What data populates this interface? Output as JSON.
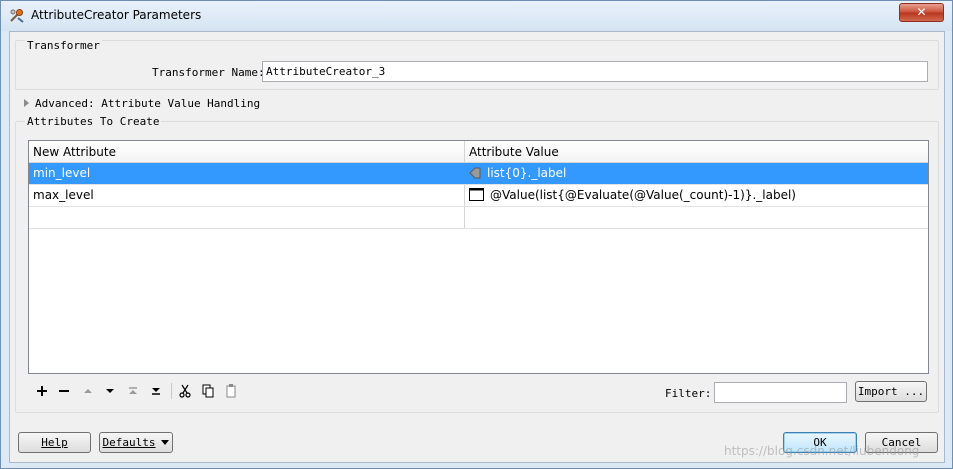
{
  "window": {
    "title": "AttributeCreator Parameters",
    "close_label": "✕"
  },
  "transformer_group": {
    "label": "Transformer",
    "name_label": "Transformer Name:",
    "name_value": "AttributeCreator_3"
  },
  "advanced": {
    "label": "Advanced: Attribute Value Handling",
    "expanded": false
  },
  "attributes_group": {
    "label": "Attributes To Create",
    "columns": [
      "New Attribute",
      "Attribute Value"
    ],
    "rows": [
      {
        "attribute": "min_level",
        "value": "list{0}._label",
        "value_icon": "attribute-icon",
        "selected": true
      },
      {
        "attribute": "max_level",
        "value": "@Value(list{@Evaluate(@Value(_count)-1)}._label)",
        "value_icon": "expression-icon",
        "selected": false
      },
      {
        "attribute": "",
        "value": "",
        "selected": false
      }
    ]
  },
  "toolbar": {
    "icons": [
      "add-icon",
      "remove-icon",
      "move-up-icon",
      "move-down-icon",
      "move-to-top-icon",
      "move-to-bottom-icon",
      "cut-icon",
      "copy-icon",
      "paste-icon"
    ]
  },
  "filter": {
    "label": "Filter:",
    "value": ""
  },
  "buttons": {
    "import": "Import ...",
    "help": "Help",
    "defaults": "Defaults",
    "ok": "OK",
    "cancel": "Cancel"
  },
  "watermark": "https://blog.csdn.net/liubendong"
}
